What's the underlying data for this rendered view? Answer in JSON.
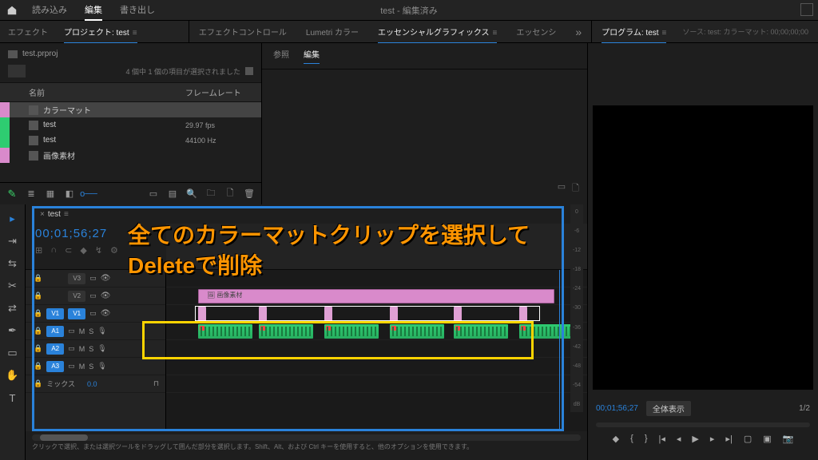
{
  "app": {
    "title": "test - 編集済み",
    "top_tabs": [
      "読み込み",
      "編集",
      "書き出し"
    ],
    "active_top_tab": 1
  },
  "workspace": {
    "left_tabs": {
      "effect": "エフェクト",
      "project": "プロジェクト: test"
    },
    "mid_tabs": [
      "エフェクトコントロール",
      "Lumetri カラー",
      "エッセンシャルグラフィックス",
      "エッセンシ"
    ],
    "right_tabs": {
      "program": "プログラム: test",
      "source": "ソース: test: カラーマット: 00;00;00;00"
    }
  },
  "project": {
    "filename": "test.prproj",
    "status": "4 個中 1 個の項目が選択されました",
    "cols": {
      "name": "名前",
      "rate": "フレームレート"
    },
    "items": [
      {
        "swatch": "#d98acb",
        "icon": "file",
        "name": "カラーマット",
        "rate": "",
        "sel": true
      },
      {
        "swatch": "#2ecc71",
        "icon": "seq",
        "name": "test",
        "rate": "29.97 fps"
      },
      {
        "swatch": "#2ecc71",
        "icon": "audio",
        "name": "test",
        "rate": "44100 Hz"
      },
      {
        "swatch": "#d98acb",
        "icon": "bin",
        "name": "画像素材",
        "rate": ""
      }
    ]
  },
  "effect_panel": {
    "tabs": [
      "参照",
      "編集"
    ]
  },
  "timeline": {
    "seq_name": "test",
    "timecode": "00;01;56;27",
    "tracks_v": [
      "V3",
      "V2",
      "V1"
    ],
    "tracks_a": [
      "A1",
      "A2",
      "A3"
    ],
    "mix_label": "ミックス",
    "mix_val": "0.0",
    "clip_label": "画像素材"
  },
  "program": {
    "timecode": "00;01;56;27",
    "fit": "全体表示",
    "fraction": "1/2"
  },
  "meter_ticks": [
    "0",
    "-6",
    "-12",
    "-18",
    "-24",
    "-30",
    "-36",
    "-42",
    "-48",
    "-54",
    "dB"
  ],
  "overlay": {
    "line1": "全てのカラーマットクリップを選択して",
    "line2": "Deleteで削除"
  },
  "status": "クリックで選択、または選択ツールをドラッグして囲んだ部分を選択します。Shift、Alt、および Ctrl キーを使用すると、他のオプションを使用できます。"
}
